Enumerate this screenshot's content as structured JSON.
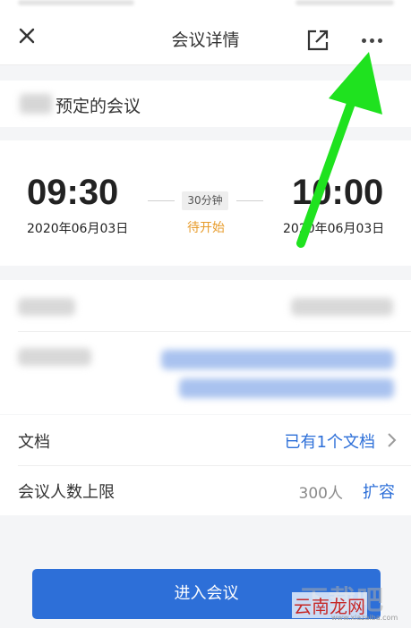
{
  "header": {
    "title": "会议详情",
    "close_icon": "close-icon",
    "share_icon": "share-icon",
    "more_icon": "more-icon"
  },
  "organizer": {
    "label": "预定的会议"
  },
  "schedule": {
    "start_time": "09:30",
    "start_date": "2020年06月03日",
    "duration": "30分钟",
    "status": "待开始",
    "end_time": "10:00",
    "end_date": "2020年06月03日"
  },
  "documents": {
    "label": "文档",
    "value": "已有1个文档"
  },
  "capacity": {
    "label": "会议人数上限",
    "value": "300人",
    "action": "扩容"
  },
  "join_button": {
    "label": "进入会议"
  },
  "watermark": {
    "text": "云南龙网",
    "back": "下载吧",
    "url": "www.xiazaiba.com"
  },
  "colors": {
    "accent": "#2d6fd8",
    "status": "#e79b2a",
    "annotation_arrow": "#1fe21f"
  }
}
